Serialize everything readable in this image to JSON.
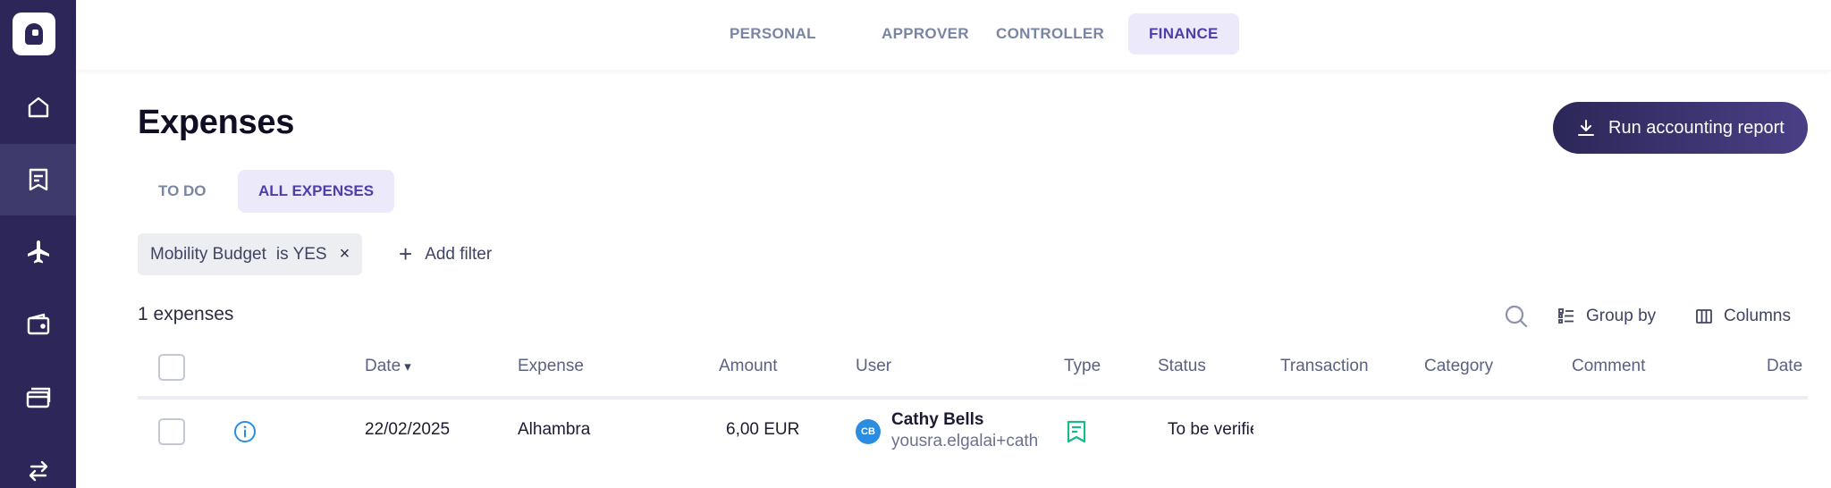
{
  "role_tabs": [
    {
      "label": "PERSONAL",
      "active": false
    },
    {
      "label": "APPROVER",
      "active": false
    },
    {
      "label": "CONTROLLER",
      "active": false
    },
    {
      "label": "FINANCE",
      "active": true
    }
  ],
  "sidebar": {
    "items": [
      {
        "icon": "home-icon"
      },
      {
        "icon": "receipt-icon",
        "active": true
      },
      {
        "icon": "airplane-icon"
      },
      {
        "icon": "wallet-icon"
      },
      {
        "icon": "cards-icon"
      },
      {
        "icon": "transfer-icon"
      }
    ]
  },
  "page": {
    "title": "Expenses",
    "run_report_label": "Run accounting report"
  },
  "sub_tabs": [
    {
      "label": "TO DO",
      "active": false
    },
    {
      "label": "ALL EXPENSES",
      "active": true
    }
  ],
  "filters": {
    "chip": {
      "field": "Mobility Budget",
      "operator": "is YES",
      "remove": "×"
    },
    "add_filter_label": "Add filter"
  },
  "list": {
    "count_label": "1 expenses",
    "group_by_label": "Group by",
    "columns_label": "Columns"
  },
  "table": {
    "headers": {
      "date": "Date",
      "expense": "Expense",
      "amount": "Amount",
      "user": "User",
      "type": "Type",
      "status": "Status",
      "transaction": "Transaction",
      "category": "Category",
      "comment": "Comment",
      "date2": "Date"
    },
    "rows": [
      {
        "date": "22/02/2025",
        "expense": "Alhambra",
        "amount": "6,00 EUR",
        "user_initials": "CB",
        "user_name": "Cathy Bells",
        "user_email": "yousra.elgalai+cathy",
        "type_icon": "receipt-icon",
        "status": "To be verified"
      }
    ]
  },
  "colors": {
    "sidebar": "#2c2758",
    "accent": "#4f3ea8",
    "tab_active_bg": "#ece9fb",
    "type_icon": "#19b98a",
    "info_icon": "#2a8de0"
  }
}
